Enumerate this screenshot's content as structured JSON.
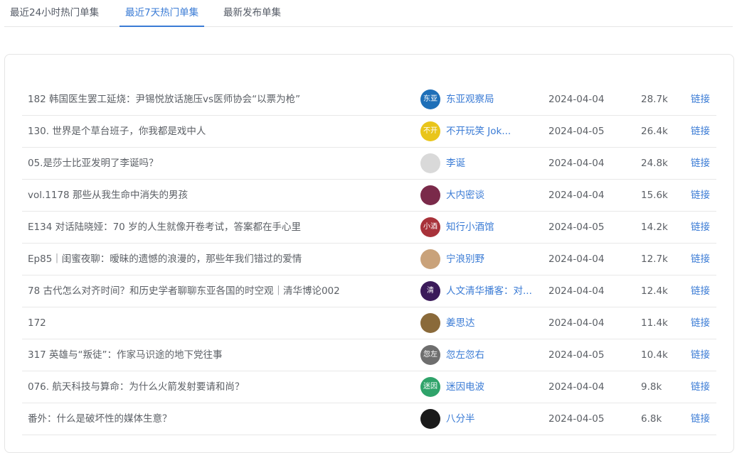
{
  "tabs": [
    {
      "label": "最近24小时热门单集"
    },
    {
      "label": "最近7天热门单集"
    },
    {
      "label": "最新发布单集"
    }
  ],
  "active_tab": 1,
  "episodes": [
    {
      "title": "182 韩国医生罢工延烧：尹锡悦放话施压vs医师协会“以票为枪”",
      "podcast": "东亚观察局",
      "date": "2024-04-04",
      "plays": "28.7k",
      "link": "链接",
      "avatar_color": "#1e6fb8",
      "avatar_text": "东亚"
    },
    {
      "title": "130. 世界是个草台班子，你我都是戏中人",
      "podcast": "不开玩笑 Jok...",
      "date": "2024-04-05",
      "plays": "26.4k",
      "link": "链接",
      "avatar_color": "#e9c51a",
      "avatar_text": "不开"
    },
    {
      "title": "05.是莎士比亚发明了李诞吗？",
      "podcast": "李诞",
      "date": "2024-04-04",
      "plays": "24.8k",
      "link": "链接",
      "avatar_color": "#d9d9d9",
      "avatar_text": ""
    },
    {
      "title": "vol.1178 那些从我生命中消失的男孩",
      "podcast": "大内密谈",
      "date": "2024-04-04",
      "plays": "15.6k",
      "link": "链接",
      "avatar_color": "#7a2a4a",
      "avatar_text": ""
    },
    {
      "title": "E134 对话陆晓娅：70 岁的人生就像开卷考试，答案都在手心里",
      "podcast": "知行小酒馆",
      "date": "2024-04-05",
      "plays": "14.2k",
      "link": "链接",
      "avatar_color": "#a8323a",
      "avatar_text": "小酒"
    },
    {
      "title": "Ep85｜闺蜜夜聊：暧昧的遗憾的浪漫的，那些年我们错过的爱情",
      "podcast": "宁浪别野",
      "date": "2024-04-04",
      "plays": "12.7k",
      "link": "链接",
      "avatar_color": "#c9a27a",
      "avatar_text": ""
    },
    {
      "title": "78 古代怎么对齐时间？和历史学者聊聊东亚各国的时空观｜清华博论002",
      "podcast": "人文清华播客：对...",
      "date": "2024-04-04",
      "plays": "12.4k",
      "link": "链接",
      "avatar_color": "#3b1b5a",
      "avatar_text": "清"
    },
    {
      "title": "172",
      "podcast": "姜思达",
      "date": "2024-04-04",
      "plays": "11.4k",
      "link": "链接",
      "avatar_color": "#8a6a3a",
      "avatar_text": ""
    },
    {
      "title": "317 英雄与“叛徒”：作家马识途的地下党往事",
      "podcast": "忽左忽右",
      "date": "2024-04-05",
      "plays": "10.4k",
      "link": "链接",
      "avatar_color": "#6e6e6e",
      "avatar_text": "忽左"
    },
    {
      "title": "076. 航天科技与算命：为什么火箭发射要请和尚？",
      "podcast": "迷因电波",
      "date": "2024-04-04",
      "plays": "9.8k",
      "link": "链接",
      "avatar_color": "#2fa36a",
      "avatar_text": "迷因"
    },
    {
      "title": "番外：什么是破坏性的媒体生意？",
      "podcast": "八分半",
      "date": "2024-04-05",
      "plays": "6.8k",
      "link": "链接",
      "avatar_color": "#1a1a1a",
      "avatar_text": ""
    }
  ]
}
